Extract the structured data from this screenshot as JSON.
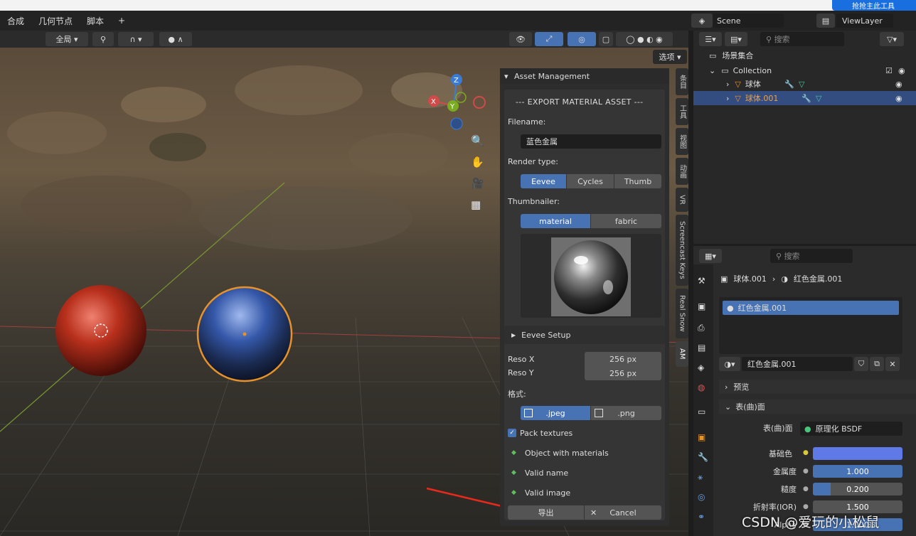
{
  "menubar": {
    "items": [
      "合成",
      "几何节点",
      "脚本",
      "+"
    ]
  },
  "header": {
    "global_label": "全局",
    "options_label": "选项"
  },
  "scene": {
    "name": "Scene",
    "view_layer": "ViewLayer",
    "overlay_text": "抢抢主此工具"
  },
  "gizmo": {
    "z": "Z",
    "x": "X",
    "y": "Y"
  },
  "panel": {
    "title": "Asset Management",
    "export_heading": "--- EXPORT MATERIAL ASSET ---",
    "filename_label": "Filename:",
    "filename_value": "蓝色金属",
    "render_type_label": "Render type:",
    "render_types": [
      "Eevee",
      "Cycles",
      "Thumb"
    ],
    "thumbnailer_label": "Thumbnailer:",
    "thumbnailers": [
      "material",
      "fabric"
    ],
    "eevee_setup": "Eevee Setup",
    "reso_x_label": "Reso X",
    "reso_x": "256 px",
    "reso_y_label": "Reso Y",
    "reso_y": "256 px",
    "format_label": "格式:",
    "formats": [
      ".jpeg",
      ".png"
    ],
    "pack_textures": "Pack textures",
    "checks": [
      "Object with materials",
      "Valid name",
      "Valid image"
    ],
    "export_btn": "导出",
    "cancel_btn": "Cancel"
  },
  "sidetabs": [
    "条目",
    "工具",
    "视图",
    "动画",
    "VR",
    "Screencast Keys",
    "Real Snow",
    "AM"
  ],
  "outliner": {
    "search_placeholder": "搜索",
    "scene_collection": "场景集合",
    "collection": "Collection",
    "items": [
      "球体",
      "球体.001"
    ]
  },
  "props": {
    "search_placeholder": "搜索",
    "breadcrumb_obj": "球体.001",
    "breadcrumb_mat": "红色金属.001",
    "slot": "红色金属.001",
    "material_name": "红色金属.001",
    "preview": "预览",
    "surface": "表(曲)面",
    "surface_label": "表(曲)面",
    "shader": "原理化 BSDF",
    "base_color_label": "基础色",
    "rows": [
      {
        "label": "金属度",
        "value": "1.000",
        "fraction": 1.0
      },
      {
        "label": "糙度",
        "value": "0.200",
        "fraction": 0.2
      },
      {
        "label": "折射率(IOR)",
        "value": "1.500",
        "fraction": 0.0
      },
      {
        "label": "Alpha",
        "value": "1.000",
        "fraction": 1.0
      }
    ]
  },
  "watermark": "CSDN @爱玩的小松鼠",
  "colors": {
    "accent": "#4772b3",
    "base_color": "#5f7ae6",
    "selection": "#e8922a"
  }
}
